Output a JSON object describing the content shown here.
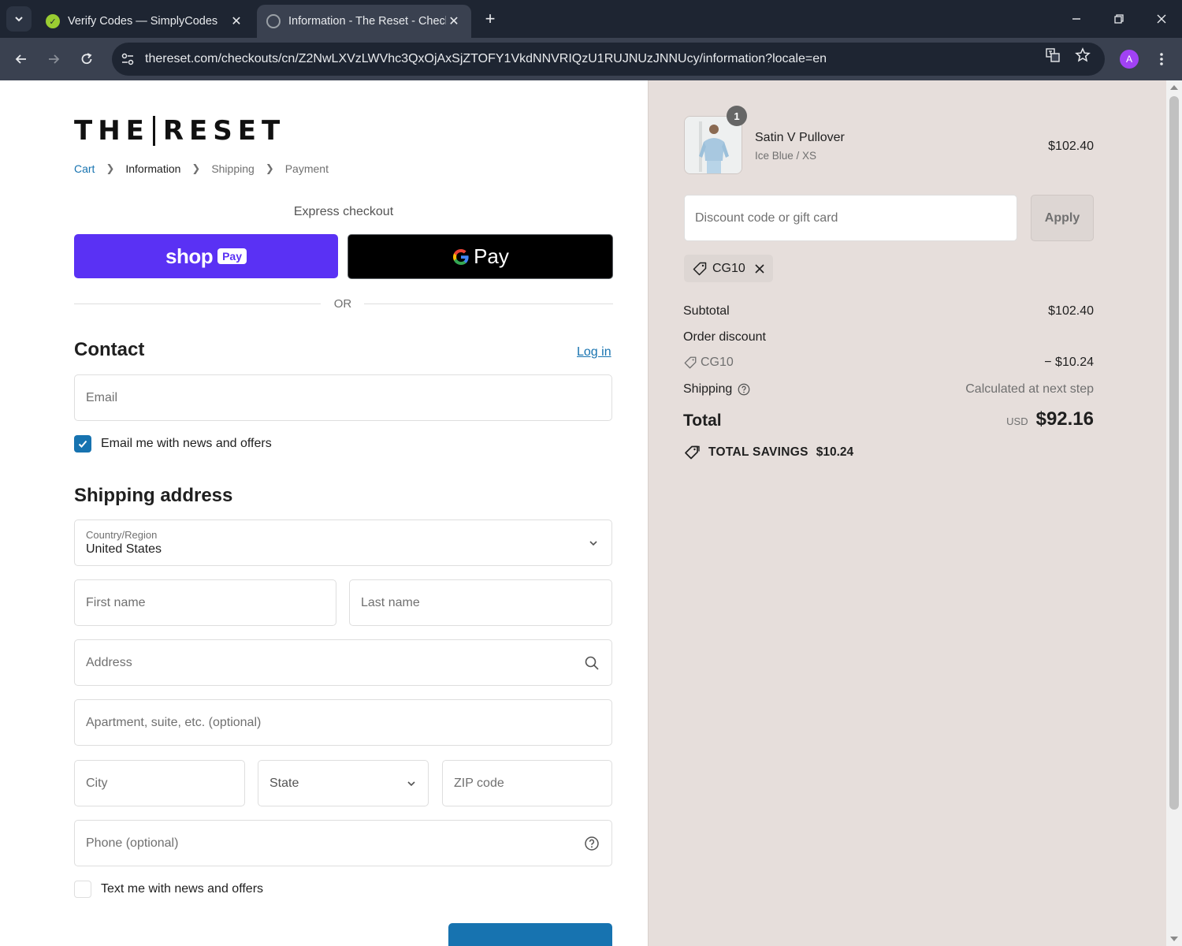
{
  "browser": {
    "tabs": [
      {
        "title": "Verify Codes — SimplyCodes",
        "active": false
      },
      {
        "title": "Information - The Reset - Check",
        "active": true
      }
    ],
    "url": "thereset.com/checkouts/cn/Z2NwLXVzLWVhc3QxOjAxSjZTOFY1VkdNNVRIQzU1RUJNUzJNNUcy/information?locale=en",
    "profile_initial": "A",
    "accent": "#a142f4"
  },
  "brand": {
    "left": "THE",
    "right": "RESET"
  },
  "breadcrumb": [
    "Cart",
    "Information",
    "Shipping",
    "Payment"
  ],
  "express": {
    "label": "Express checkout",
    "shop_word": "shop",
    "shop_pay_box": "Pay",
    "gpay_text": "Pay"
  },
  "divider": "OR",
  "contact": {
    "heading": "Contact",
    "login": "Log in",
    "email_placeholder": "Email",
    "news_label": "Email me with news and offers",
    "news_checked": true
  },
  "shipping": {
    "heading": "Shipping address",
    "country_label": "Country/Region",
    "country_value": "United States",
    "first_name": "First name",
    "last_name": "Last name",
    "address": "Address",
    "apartment": "Apartment, suite, etc. (optional)",
    "city": "City",
    "state": "State",
    "zip": "ZIP code",
    "phone": "Phone (optional)",
    "sms_label": "Text me with news and offers",
    "sms_checked": false
  },
  "summary": {
    "item": {
      "qty": "1",
      "name": "Satin V Pullover",
      "variant": "Ice Blue / XS",
      "price": "$102.40"
    },
    "discount_placeholder": "Discount code or gift card",
    "apply": "Apply",
    "applied_code": "CG10",
    "subtotal_label": "Subtotal",
    "subtotal": "$102.40",
    "order_discount_label": "Order discount",
    "discount_code": "CG10",
    "discount_amount": "− $10.24",
    "shipping_label": "Shipping",
    "shipping_value": "Calculated at next step",
    "total_label": "Total",
    "currency": "USD",
    "total": "$92.16",
    "savings_label": "TOTAL SAVINGS",
    "savings": "$10.24"
  },
  "colors": {
    "shop_pay": "#5a31f4",
    "link": "#1773b0",
    "summary_bg": "#e6dedb"
  }
}
